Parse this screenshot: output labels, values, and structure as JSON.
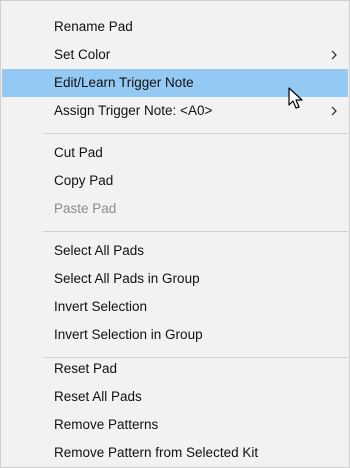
{
  "context_menu": {
    "groups": [
      {
        "items": [
          {
            "label": "Rename Pad",
            "disabled": false,
            "has_submenu": false
          },
          {
            "label": "Set Color",
            "disabled": false,
            "has_submenu": true
          },
          {
            "label": "Edit/Learn Trigger Note",
            "disabled": false,
            "has_submenu": false,
            "highlighted": true
          },
          {
            "label": "Assign Trigger Note: <A0>",
            "disabled": false,
            "has_submenu": true
          }
        ]
      },
      {
        "items": [
          {
            "label": "Cut Pad",
            "disabled": false,
            "has_submenu": false
          },
          {
            "label": "Copy Pad",
            "disabled": false,
            "has_submenu": false
          },
          {
            "label": "Paste Pad",
            "disabled": true,
            "has_submenu": false
          }
        ]
      },
      {
        "items": [
          {
            "label": "Select All Pads",
            "disabled": false,
            "has_submenu": false
          },
          {
            "label": "Select All Pads in Group",
            "disabled": false,
            "has_submenu": false
          },
          {
            "label": "Invert Selection",
            "disabled": false,
            "has_submenu": false
          },
          {
            "label": "Invert Selection in Group",
            "disabled": false,
            "has_submenu": false
          }
        ]
      },
      {
        "items": [
          {
            "label": "Reset Pad",
            "disabled": false,
            "has_submenu": false
          },
          {
            "label": "Reset All Pads",
            "disabled": false,
            "has_submenu": false
          },
          {
            "label": "Remove Patterns",
            "disabled": false,
            "has_submenu": false
          },
          {
            "label": "Remove Pattern from Selected Kit",
            "disabled": false,
            "has_submenu": false
          }
        ]
      }
    ],
    "submenu_arrow_icon": "chevron-right-icon",
    "cursor_icon": "mouse-pointer-icon",
    "colors": {
      "background": "#f2f2f2",
      "highlight": "#94c9f3",
      "text": "#111111",
      "disabled_text": "#8c8c8c",
      "separator": "#d0d0d0"
    }
  }
}
